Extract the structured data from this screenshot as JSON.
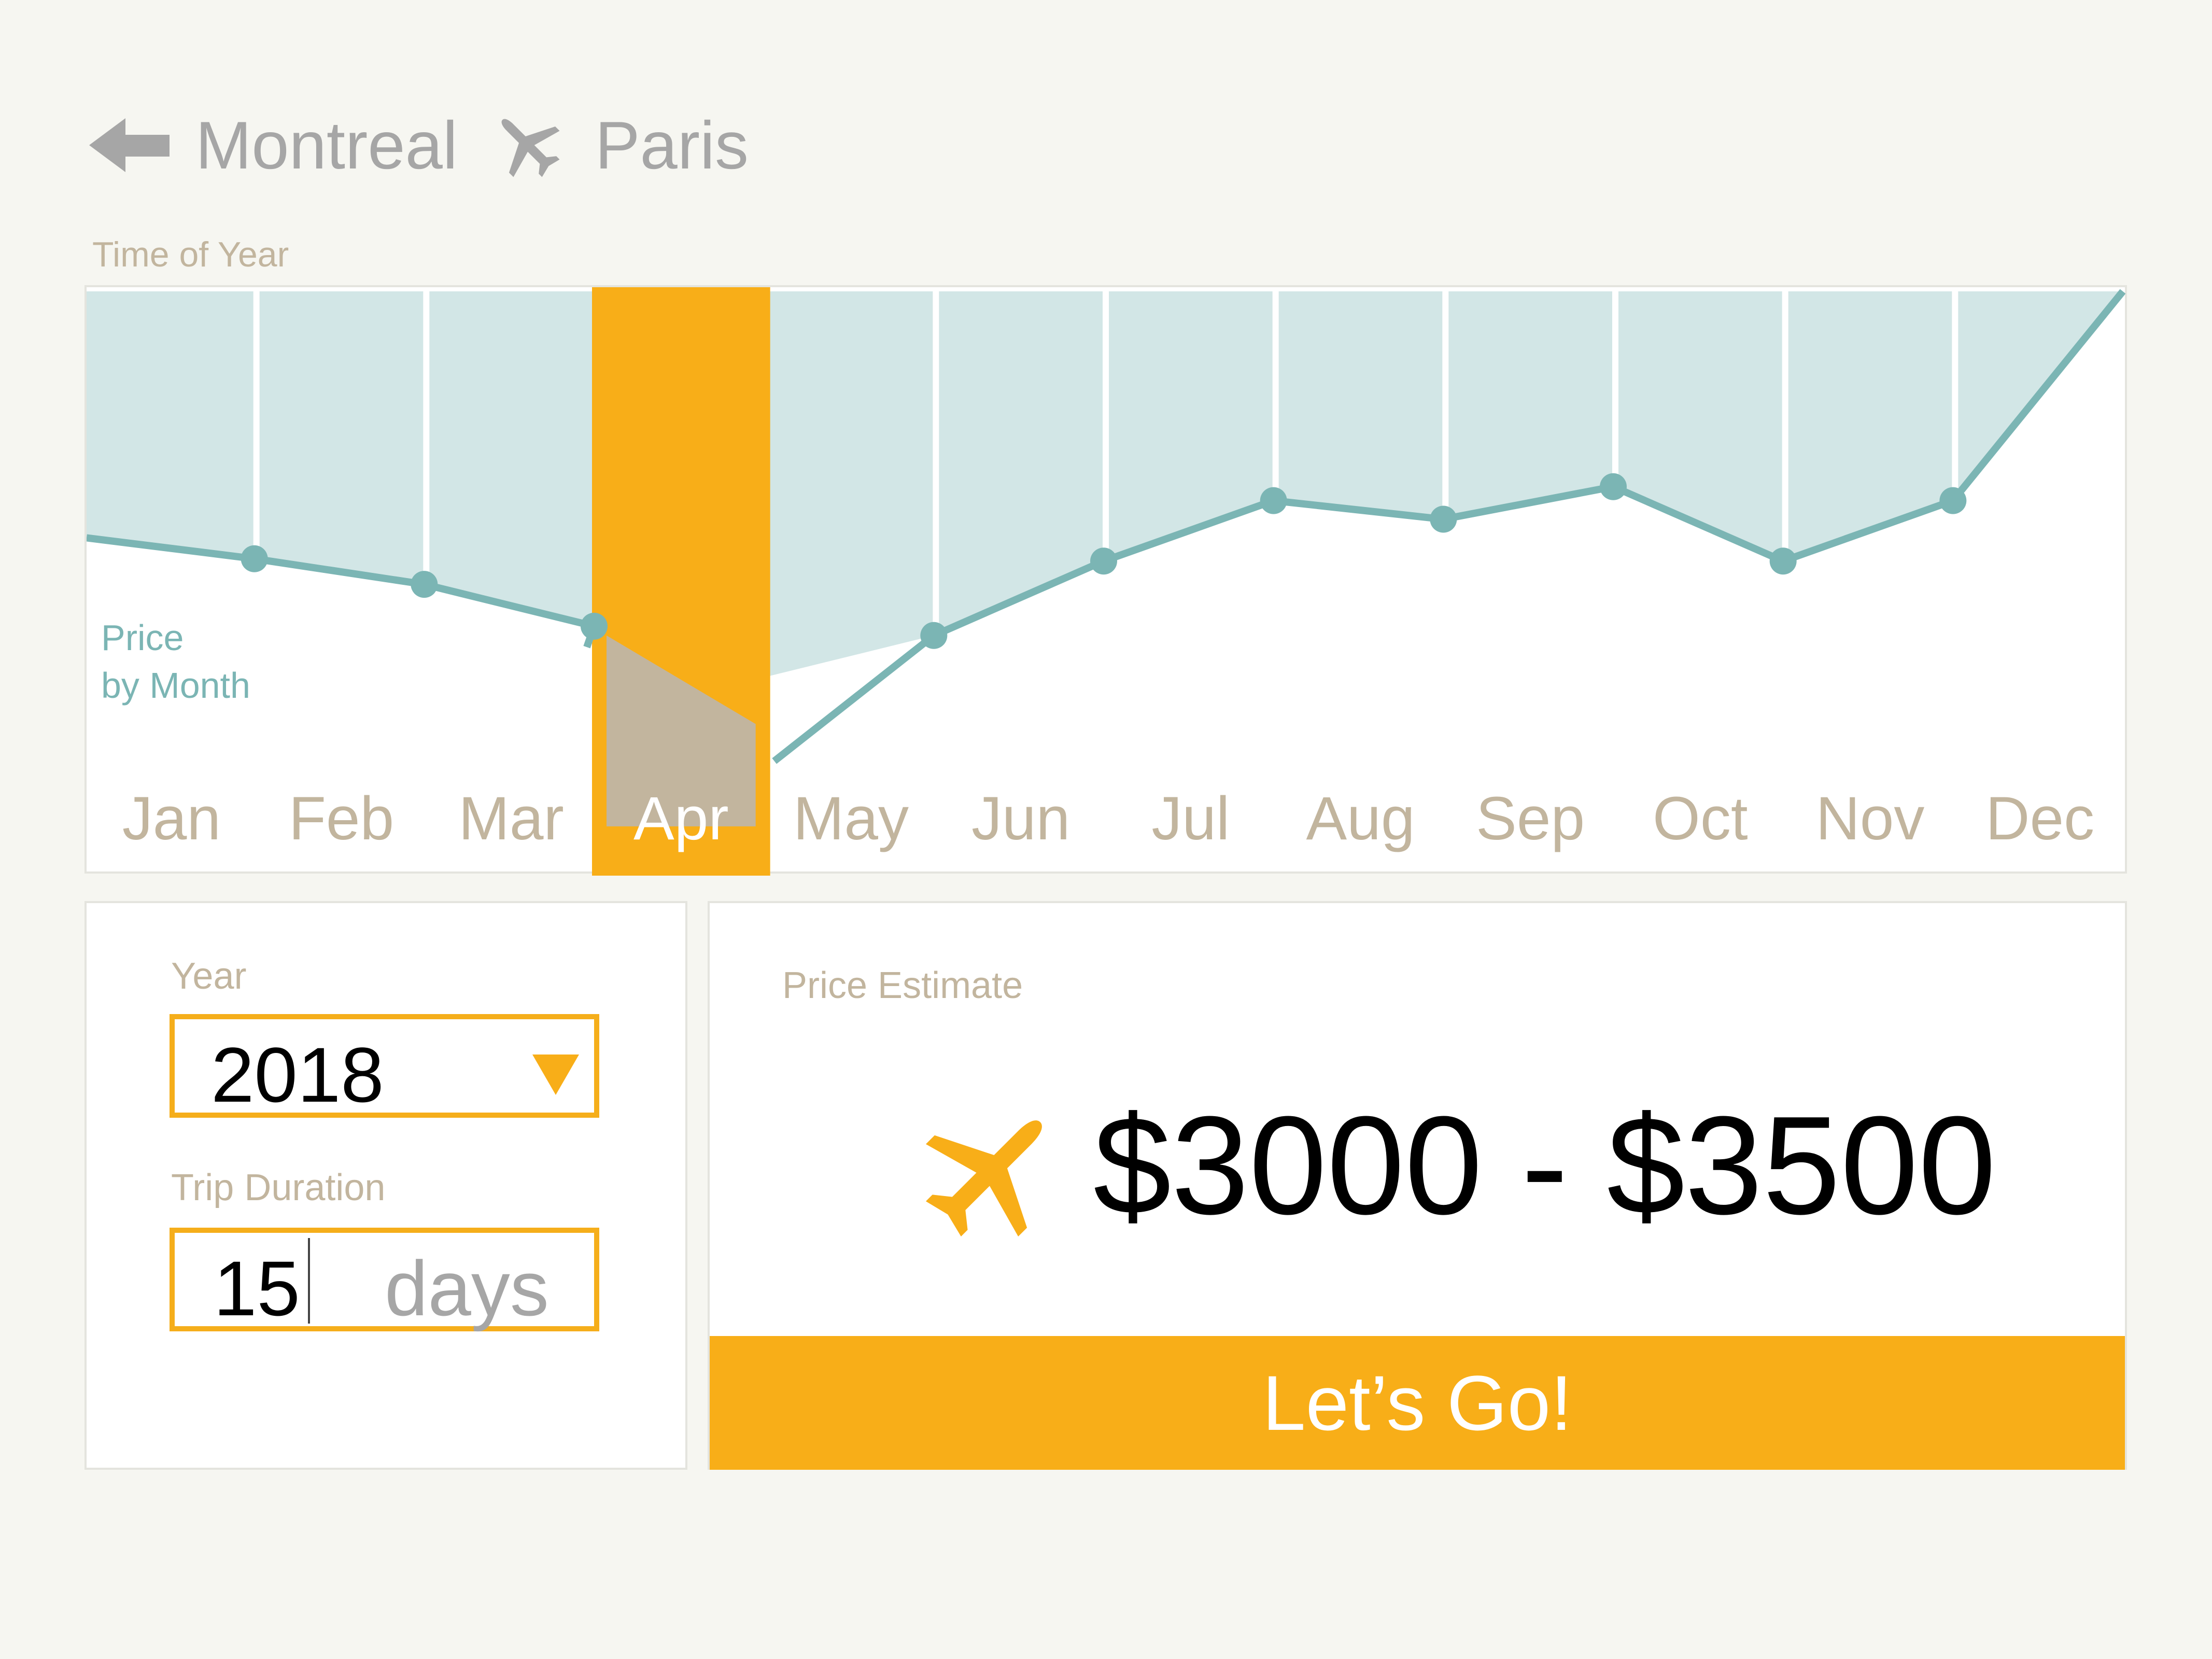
{
  "route": {
    "back_icon": "back-arrow-icon",
    "origin": "Montreal",
    "flight_icon": "airplane-icon",
    "destination": "Paris"
  },
  "chart": {
    "section_label": "Time of Year"
  },
  "chart_data": {
    "type": "line",
    "legend_label": "Price\nby Month",
    "selected_month": "Apr",
    "categories": [
      "Jan",
      "Feb",
      "Mar",
      "Apr",
      "May",
      "Jun",
      "Jul",
      "Aug",
      "Sep",
      "Oct",
      "Nov",
      "Dec"
    ],
    "series": [
      {
        "values": [
          0.425,
          0.37,
          0.28,
          0.17,
          0.26,
          0.42,
          0.55,
          0.51,
          0.58,
          0.42,
          0.55,
          1.0
        ]
      }
    ],
    "colors": {
      "line": "#7bb5b4",
      "area": "#d2e6e6",
      "selected": "#f8ae18",
      "selected_fill": "#c2b59e",
      "month_label": "#c2b59e"
    },
    "grid": true
  },
  "form": {
    "year_label": "Year",
    "year_value": "2018",
    "year_dropdown_icon": "triangle-down-icon",
    "duration_label": "Trip Duration",
    "duration_value": "15",
    "duration_unit": "days"
  },
  "estimate": {
    "label": "Price Estimate",
    "icon": "airplane-icon",
    "value": "$3000 - $3500",
    "button_label": "Let’s Go!"
  },
  "colors": {
    "accent": "#f8ae18",
    "muted_text": "#c2b59e",
    "route_text": "#a6a6a6",
    "teal": "#7bb5b4"
  }
}
